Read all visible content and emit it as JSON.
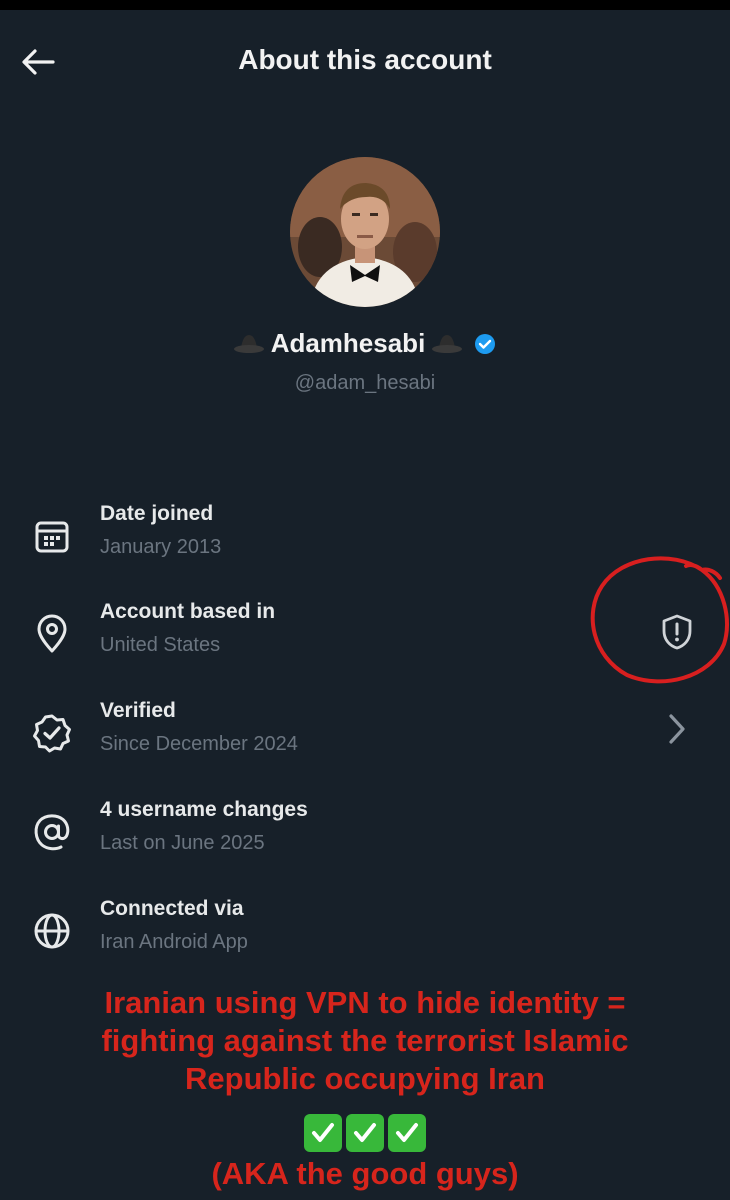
{
  "header": {
    "title": "About this account"
  },
  "profile": {
    "display_name": "Adamhesabi",
    "handle": "@adam_hesabi",
    "verified_color": "#1d9bf0"
  },
  "details": [
    {
      "title": "Date joined",
      "value": "January 2013",
      "icon": "calendar-icon"
    },
    {
      "title": "Account based in",
      "value": "United States",
      "icon": "location-pin-icon"
    },
    {
      "title": "Verified",
      "value": "Since December 2024",
      "icon": "verified-badge-icon"
    },
    {
      "title": "4 username changes",
      "value": "Last on June 2025",
      "icon": "at-sign-icon"
    },
    {
      "title": "Connected via",
      "value": "Iran Android App",
      "icon": "globe-icon"
    }
  ],
  "annotation": {
    "caption_lines": [
      "Iranian using VPN to hide identity =",
      "fighting against the terrorist Islamic",
      "Republic occupying Iran"
    ],
    "checkmarks": [
      "✓",
      "✓",
      "✓"
    ],
    "footer": "(AKA the good guys)",
    "color": "#d7251c"
  }
}
